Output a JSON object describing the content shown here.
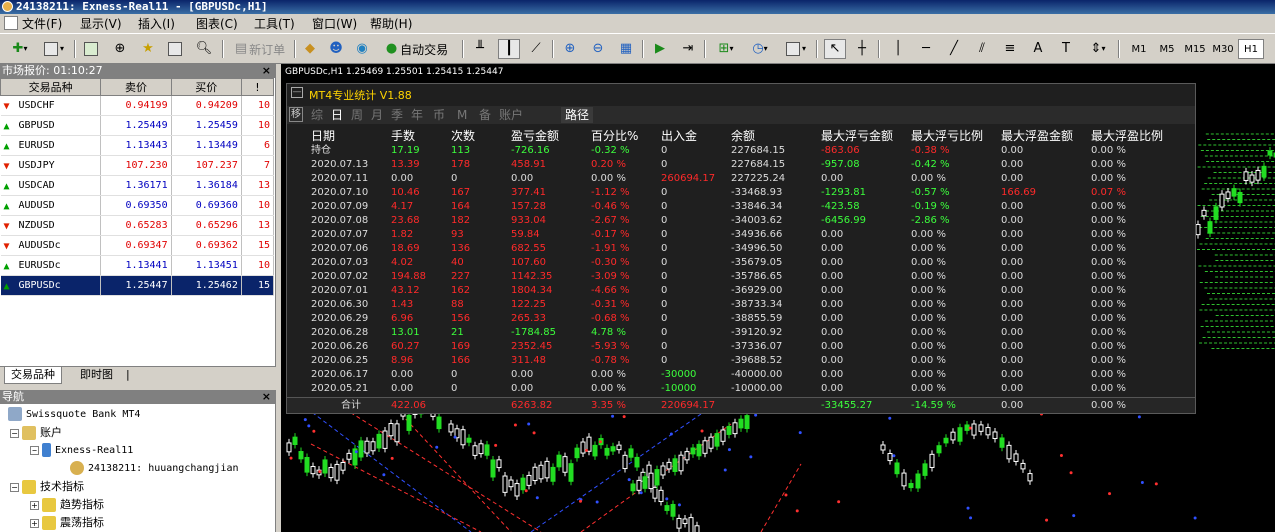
{
  "window": {
    "title": "24138211: Exness-Real11 - [GBPUSDc,H1]"
  },
  "menu": [
    "文件(F)",
    "显示(V)",
    "插入(I)",
    "图表(C)",
    "工具(T)",
    "窗口(W)",
    "帮助(H)"
  ],
  "toolbar": {
    "new_order": "新订单",
    "auto_trade": "自动交易",
    "timeframes": [
      "M1",
      "M5",
      "M15",
      "M30",
      "H1"
    ],
    "active_timeframe": "H1"
  },
  "market_watch": {
    "title": "市场报价: 01:10:27",
    "close": "×",
    "columns": [
      "交易品种",
      "卖价",
      "买价",
      "!"
    ],
    "rows": [
      {
        "symbol": "USDCHF",
        "bid": "0.94199",
        "ask": "0.94209",
        "spread": "10",
        "dir": "down"
      },
      {
        "symbol": "GBPUSD",
        "bid": "1.25449",
        "ask": "1.25459",
        "spread": "10",
        "dir": "up"
      },
      {
        "symbol": "EURUSD",
        "bid": "1.13443",
        "ask": "1.13449",
        "spread": "6",
        "dir": "up"
      },
      {
        "symbol": "USDJPY",
        "bid": "107.230",
        "ask": "107.237",
        "spread": "7",
        "dir": "down"
      },
      {
        "symbol": "USDCAD",
        "bid": "1.36171",
        "ask": "1.36184",
        "spread": "13",
        "dir": "up"
      },
      {
        "symbol": "AUDUSD",
        "bid": "0.69350",
        "ask": "0.69360",
        "spread": "10",
        "dir": "up"
      },
      {
        "symbol": "NZDUSD",
        "bid": "0.65283",
        "ask": "0.65296",
        "spread": "13",
        "dir": "down"
      },
      {
        "symbol": "AUDUSDc",
        "bid": "0.69347",
        "ask": "0.69362",
        "spread": "15",
        "dir": "down"
      },
      {
        "symbol": "EURUSDc",
        "bid": "1.13441",
        "ask": "1.13451",
        "spread": "10",
        "dir": "up"
      },
      {
        "symbol": "GBPUSDc",
        "bid": "1.25447",
        "ask": "1.25462",
        "spread": "15",
        "dir": "up"
      }
    ],
    "tabs": [
      "交易品种",
      "即时图"
    ]
  },
  "navigator": {
    "title": "导航",
    "close": "×",
    "broker": "Swissquote Bank MT4",
    "accounts": "账户",
    "server": "Exness-Real11",
    "account": "24138211: huuangchangjian",
    "indicators": "技术指标",
    "trend": "趋势指标",
    "oscillators": "震荡指标"
  },
  "chart": {
    "symbol_line": "GBPUSDc,H1  1.25469 1.25501 1.25415 1.25447"
  },
  "stats_panel": {
    "title": "MT4专业统计 V1.88",
    "min_button": "—",
    "pin": "移",
    "tabs": [
      "综",
      "日",
      "周",
      "月",
      "季",
      "年",
      "币",
      "M",
      "备",
      "账户"
    ],
    "active_tab": "日",
    "route_label": "路径",
    "headers": [
      "日期",
      "手数",
      "次数",
      "盈亏金额",
      "百分比%",
      "出入金",
      "余额",
      "最大浮亏金额",
      "最大浮亏比例",
      "最大浮盈金额",
      "最大浮盈比例"
    ],
    "rows": [
      [
        "持仓",
        "17.19",
        "113",
        "-726.16",
        "-0.32 %",
        "0",
        "227684.15",
        "-863.06",
        "-0.38 %",
        "0.00",
        "0.00 %"
      ],
      [
        "2020.07.13",
        "13.39",
        "178",
        "458.91",
        "0.20 %",
        "0",
        "227684.15",
        "-957.08",
        "-0.42 %",
        "0.00",
        "0.00 %"
      ],
      [
        "2020.07.11",
        "0.00",
        "0",
        "0.00",
        "0.00 %",
        "260694.17",
        "227225.24",
        "0.00",
        "0.00 %",
        "0.00",
        "0.00 %"
      ],
      [
        "2020.07.10",
        "10.46",
        "167",
        "377.41",
        "-1.12 %",
        "0",
        "-33468.93",
        "-1293.81",
        "-0.57 %",
        "166.69",
        "0.07 %"
      ],
      [
        "2020.07.09",
        "4.17",
        "164",
        "157.28",
        "-0.46 %",
        "0",
        "-33846.34",
        "-423.58",
        "-0.19 %",
        "0.00",
        "0.00 %"
      ],
      [
        "2020.07.08",
        "23.68",
        "182",
        "933.04",
        "-2.67 %",
        "0",
        "-34003.62",
        "-6456.99",
        "-2.86 %",
        "0.00",
        "0.00 %"
      ],
      [
        "2020.07.07",
        "1.82",
        "93",
        "59.84",
        "-0.17 %",
        "0",
        "-34936.66",
        "0.00",
        "0.00 %",
        "0.00",
        "0.00 %"
      ],
      [
        "2020.07.06",
        "18.69",
        "136",
        "682.55",
        "-1.91 %",
        "0",
        "-34996.50",
        "0.00",
        "0.00 %",
        "0.00",
        "0.00 %"
      ],
      [
        "2020.07.03",
        "4.02",
        "40",
        "107.60",
        "-0.30 %",
        "0",
        "-35679.05",
        "0.00",
        "0.00 %",
        "0.00",
        "0.00 %"
      ],
      [
        "2020.07.02",
        "194.88",
        "227",
        "1142.35",
        "-3.09 %",
        "0",
        "-35786.65",
        "0.00",
        "0.00 %",
        "0.00",
        "0.00 %"
      ],
      [
        "2020.07.01",
        "43.12",
        "162",
        "1804.34",
        "-4.66 %",
        "0",
        "-36929.00",
        "0.00",
        "0.00 %",
        "0.00",
        "0.00 %"
      ],
      [
        "2020.06.30",
        "1.43",
        "88",
        "122.25",
        "-0.31 %",
        "0",
        "-38733.34",
        "0.00",
        "0.00 %",
        "0.00",
        "0.00 %"
      ],
      [
        "2020.06.29",
        "6.96",
        "156",
        "265.33",
        "-0.68 %",
        "0",
        "-38855.59",
        "0.00",
        "0.00 %",
        "0.00",
        "0.00 %"
      ],
      [
        "2020.06.28",
        "13.01",
        "21",
        "-1784.85",
        "4.78 %",
        "0",
        "-39120.92",
        "0.00",
        "0.00 %",
        "0.00",
        "0.00 %"
      ],
      [
        "2020.06.26",
        "60.27",
        "169",
        "2352.45",
        "-5.93 %",
        "0",
        "-37336.07",
        "0.00",
        "0.00 %",
        "0.00",
        "0.00 %"
      ],
      [
        "2020.06.25",
        "8.96",
        "166",
        "311.48",
        "-0.78 %",
        "0",
        "-39688.52",
        "0.00",
        "0.00 %",
        "0.00",
        "0.00 %"
      ],
      [
        "2020.06.17",
        "0.00",
        "0",
        "0.00",
        "0.00 %",
        "-30000",
        "-40000.00",
        "0.00",
        "0.00 %",
        "0.00",
        "0.00 %"
      ],
      [
        "2020.05.21",
        "0.00",
        "0",
        "0.00",
        "0.00 %",
        "-10000",
        "-10000.00",
        "0.00",
        "0.00 %",
        "0.00",
        "0.00 %"
      ]
    ],
    "row_colors": [
      [
        "w",
        "g",
        "g",
        "g",
        "g",
        "w",
        "w",
        "r",
        "r",
        "w",
        "w"
      ],
      [
        "w",
        "r",
        "r",
        "r",
        "r",
        "w",
        "w",
        "g",
        "g",
        "w",
        "w"
      ],
      [
        "w",
        "w",
        "w",
        "w",
        "w",
        "r",
        "w",
        "w",
        "w",
        "w",
        "w"
      ],
      [
        "w",
        "r",
        "r",
        "r",
        "r",
        "w",
        "w",
        "g",
        "g",
        "r",
        "r"
      ],
      [
        "w",
        "r",
        "r",
        "r",
        "r",
        "w",
        "w",
        "g",
        "g",
        "w",
        "w"
      ],
      [
        "w",
        "r",
        "r",
        "r",
        "r",
        "w",
        "w",
        "g",
        "g",
        "w",
        "w"
      ],
      [
        "w",
        "r",
        "r",
        "r",
        "r",
        "w",
        "w",
        "w",
        "w",
        "w",
        "w"
      ],
      [
        "w",
        "r",
        "r",
        "r",
        "r",
        "w",
        "w",
        "w",
        "w",
        "w",
        "w"
      ],
      [
        "w",
        "r",
        "r",
        "r",
        "r",
        "w",
        "w",
        "w",
        "w",
        "w",
        "w"
      ],
      [
        "w",
        "r",
        "r",
        "r",
        "r",
        "w",
        "w",
        "w",
        "w",
        "w",
        "w"
      ],
      [
        "w",
        "r",
        "r",
        "r",
        "r",
        "w",
        "w",
        "w",
        "w",
        "w",
        "w"
      ],
      [
        "w",
        "r",
        "r",
        "r",
        "r",
        "w",
        "w",
        "w",
        "w",
        "w",
        "w"
      ],
      [
        "w",
        "r",
        "r",
        "r",
        "r",
        "w",
        "w",
        "w",
        "w",
        "w",
        "w"
      ],
      [
        "w",
        "g",
        "g",
        "g",
        "g",
        "w",
        "w",
        "w",
        "w",
        "w",
        "w"
      ],
      [
        "w",
        "r",
        "r",
        "r",
        "r",
        "w",
        "w",
        "w",
        "w",
        "w",
        "w"
      ],
      [
        "w",
        "r",
        "r",
        "r",
        "r",
        "w",
        "w",
        "w",
        "w",
        "w",
        "w"
      ],
      [
        "w",
        "w",
        "w",
        "w",
        "w",
        "g",
        "w",
        "w",
        "w",
        "w",
        "w"
      ],
      [
        "w",
        "w",
        "w",
        "w",
        "w",
        "g",
        "w",
        "w",
        "w",
        "w",
        "w"
      ]
    ],
    "totals": {
      "label": "合计",
      "lots": "422.06",
      "pl": "6263.82",
      "pct": "3.35 %",
      "io": "220694.17",
      "mfl": "-33455.27",
      "mflp": "-14.59 %",
      "mfp": "0.00",
      "mfpp": "0.00 %"
    }
  },
  "colors": {
    "title_bar": "#0a246a",
    "profit": "#3cff3c",
    "loss": "#ff2a2a",
    "panel_title": "#ffd400",
    "selected_row": "#0a246a"
  }
}
